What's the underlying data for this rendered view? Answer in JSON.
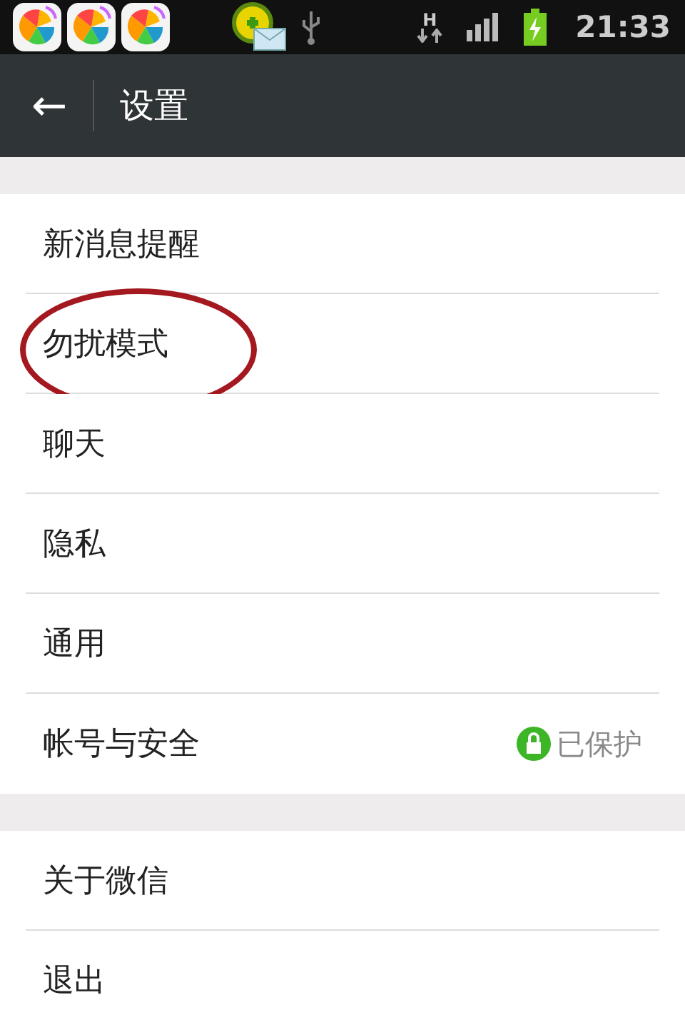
{
  "status_bar": {
    "app_icons": [
      {
        "kind": "app"
      },
      {
        "kind": "app"
      },
      {
        "kind": "app"
      }
    ],
    "network_type": "H",
    "time": "21:33"
  },
  "header": {
    "back": "←",
    "title": "设置"
  },
  "groups": [
    {
      "items": [
        {
          "label": "新消息提醒",
          "circled": false
        },
        {
          "label": "勿扰模式",
          "circled": true
        },
        {
          "label": "聊天",
          "circled": false
        },
        {
          "label": "隐私",
          "circled": false
        },
        {
          "label": "通用",
          "circled": false
        },
        {
          "label": "帐号与安全",
          "circled": false,
          "status": "已保护"
        }
      ]
    },
    {
      "items": [
        {
          "label": "关于微信",
          "circled": false
        },
        {
          "label": "退出",
          "circled": false
        }
      ]
    }
  ]
}
